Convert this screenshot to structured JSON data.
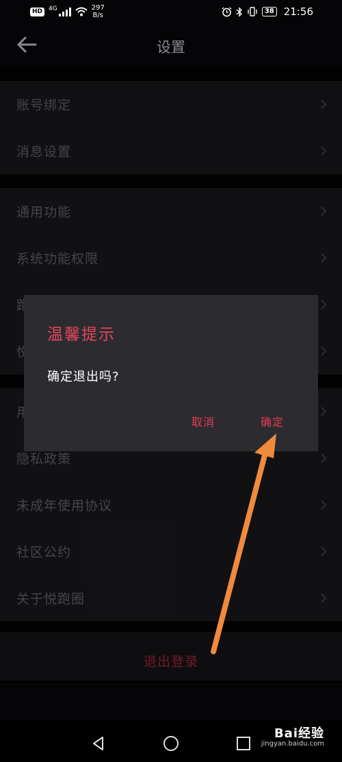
{
  "status_bar": {
    "hd": "HD",
    "network": "4G",
    "speed_value": "297",
    "speed_unit": "B/s",
    "battery": "38",
    "time": "21:56"
  },
  "header": {
    "title": "设置"
  },
  "settings": {
    "group1": [
      {
        "label": "账号绑定"
      },
      {
        "label": "消息设置"
      }
    ],
    "group2": [
      {
        "label": "通用功能"
      },
      {
        "label": "系统功能权限"
      },
      {
        "label": "跑"
      },
      {
        "label": "悦"
      }
    ],
    "group3": [
      {
        "label": "用"
      },
      {
        "label": "隐私政策"
      },
      {
        "label": "未成年使用协议"
      },
      {
        "label": "社区公约"
      },
      {
        "label": "关于悦跑圈"
      }
    ],
    "logout": "退出登录"
  },
  "dialog": {
    "title": "温馨提示",
    "message": "确定退出吗?",
    "cancel": "取消",
    "confirm": "确定"
  },
  "annotation": {
    "arrow_color": "#f08a3c"
  },
  "watermark": {
    "main": "Bai经验",
    "sub": "jingyan.baidu.com"
  },
  "colors": {
    "accent": "#e63a56",
    "background": "#050507",
    "row_bg": "#202024",
    "dialog_bg": "#2c2c30"
  }
}
